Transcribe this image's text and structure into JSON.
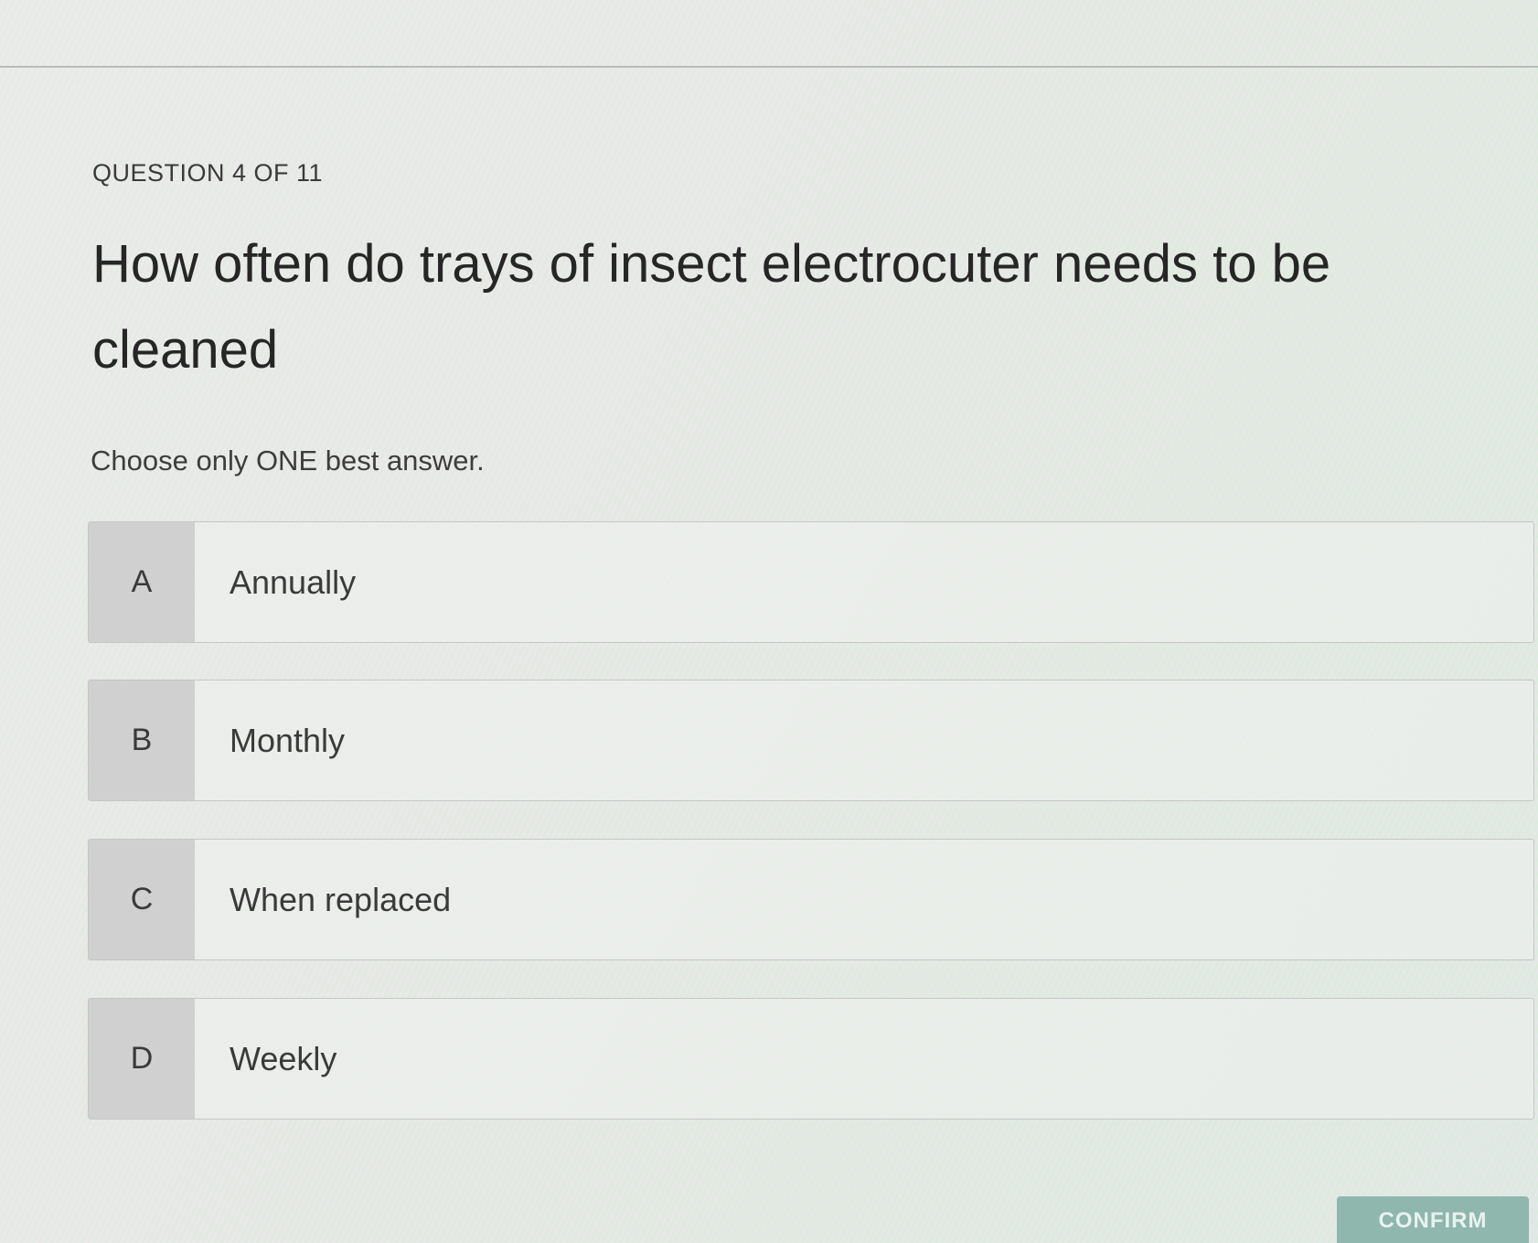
{
  "quiz": {
    "counter": "QUESTION 4 OF 11",
    "question": "How often do trays of insect electrocuter needs to be cleaned",
    "instruction": "Choose only ONE best answer.",
    "options": [
      {
        "letter": "A",
        "text": "Annually"
      },
      {
        "letter": "B",
        "text": "Monthly"
      },
      {
        "letter": "C",
        "text": "When replaced"
      },
      {
        "letter": "D",
        "text": "Weekly"
      }
    ],
    "confirm_label": "CONFIRM"
  },
  "colors": {
    "letter_box": "#cfd0cf",
    "confirm_button": "#8fb7ad"
  }
}
